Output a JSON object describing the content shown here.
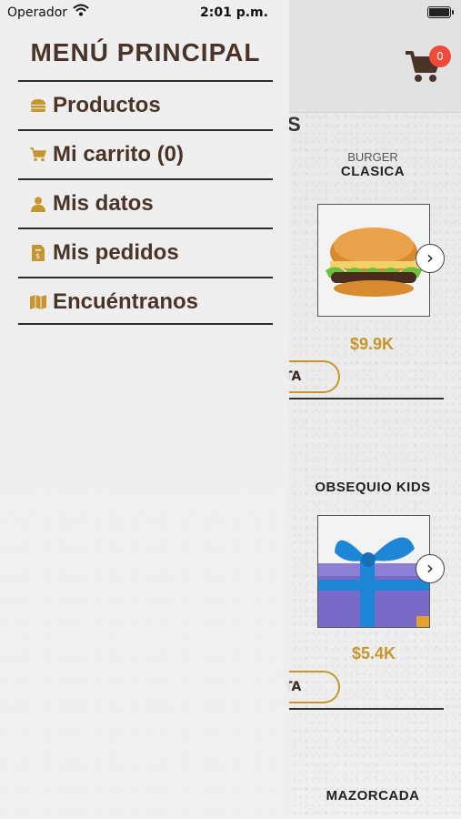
{
  "status_bar": {
    "carrier": "Operador",
    "time": "2:01 p.m."
  },
  "header": {
    "cart_count": "0"
  },
  "side_menu": {
    "title": "MENÚ PRINCIPAL",
    "items": [
      {
        "label": "Productos",
        "icon": "burger-icon"
      },
      {
        "label": "Mi carrito (0)",
        "icon": "cart-icon"
      },
      {
        "label": "Mis datos",
        "icon": "user-icon"
      },
      {
        "label": "Mis pedidos",
        "icon": "receipt-icon"
      },
      {
        "label": "Encuéntranos",
        "icon": "map-icon"
      }
    ]
  },
  "products": {
    "section_fragment": "S",
    "items": [
      {
        "subtitle": "BURGER",
        "title": "CLASICA",
        "price": "$9.9K",
        "button": "TA"
      },
      {
        "title": "OBSEQUIO KIDS",
        "price": "$5.4K",
        "button": "TA"
      },
      {
        "title": "MAZORCADA"
      }
    ]
  },
  "colors": {
    "accent": "#c8962f",
    "brown": "#4a3428",
    "badge": "#f04a3a"
  }
}
